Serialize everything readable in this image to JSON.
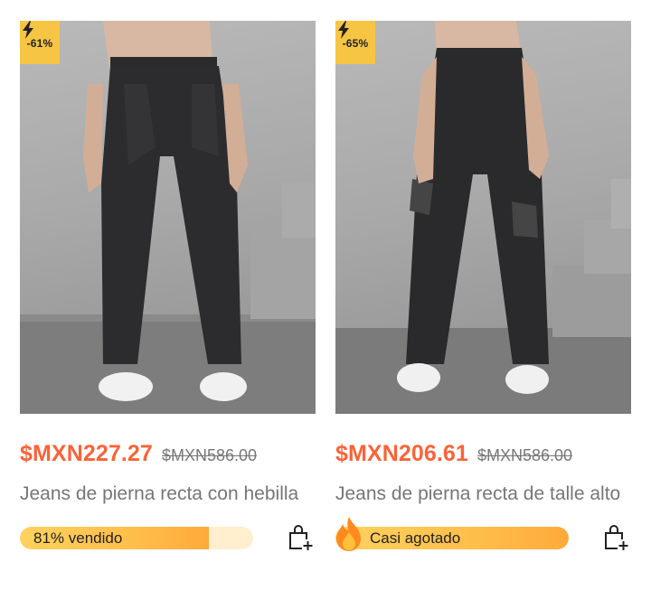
{
  "products": [
    {
      "discount_badge": "-61%",
      "price": "$MXN227.27",
      "original_price": "$MXN586.00",
      "title": "Jeans de pierna recta con hebilla",
      "stock_label": "81% vendido",
      "sold_fraction": 0.81,
      "icon": "add-to-bag-icon"
    },
    {
      "discount_badge": "-65%",
      "price": "$MXN206.61",
      "original_price": "$MXN586.00",
      "title": "Jeans de pierna recta de talle alto",
      "stock_label": "Casi agotado",
      "sold_fraction": 1.0,
      "icon": "add-to-bag-icon"
    }
  ],
  "colors": {
    "price": "#fa6338",
    "badge": "#f7c544",
    "progress_fill": "#ffbe4a",
    "progress_track": "#ffefcf"
  }
}
